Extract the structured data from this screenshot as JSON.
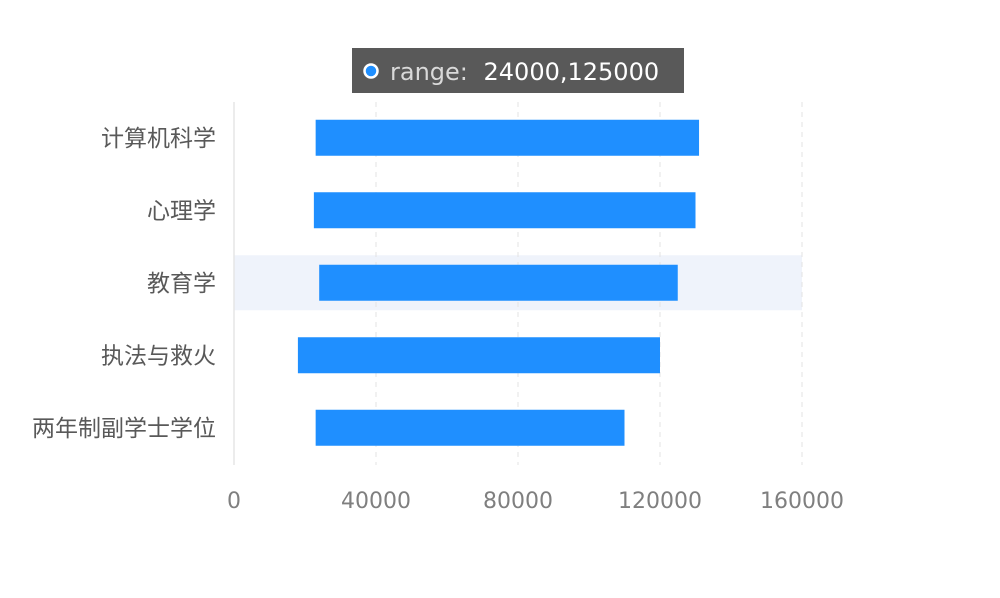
{
  "chart_data": {
    "type": "bar",
    "orientation": "horizontal",
    "categories": [
      "计算机科学",
      "心理学",
      "教育学",
      "执法与救火",
      "两年制副学士学位"
    ],
    "series": [
      {
        "ranges": [
          [
            23000,
            131000
          ],
          [
            22500,
            130000
          ],
          [
            24000,
            125000
          ],
          [
            18000,
            120000
          ],
          [
            23000,
            110000
          ]
        ]
      }
    ],
    "xlim": [
      0,
      160000
    ],
    "xticks": [
      "0",
      "40000",
      "80000",
      "120000",
      "160000"
    ],
    "grid": true,
    "highlighted_category": "教育学",
    "tooltip": {
      "key": "range:",
      "value": "24000,125000"
    },
    "colors": {
      "bar": "#1f8fff",
      "highlight_band": "#eff3fb",
      "tooltip_bg": "#595959",
      "tooltip_marker": "#1f8fff",
      "grid": "#e3e3e3"
    }
  }
}
